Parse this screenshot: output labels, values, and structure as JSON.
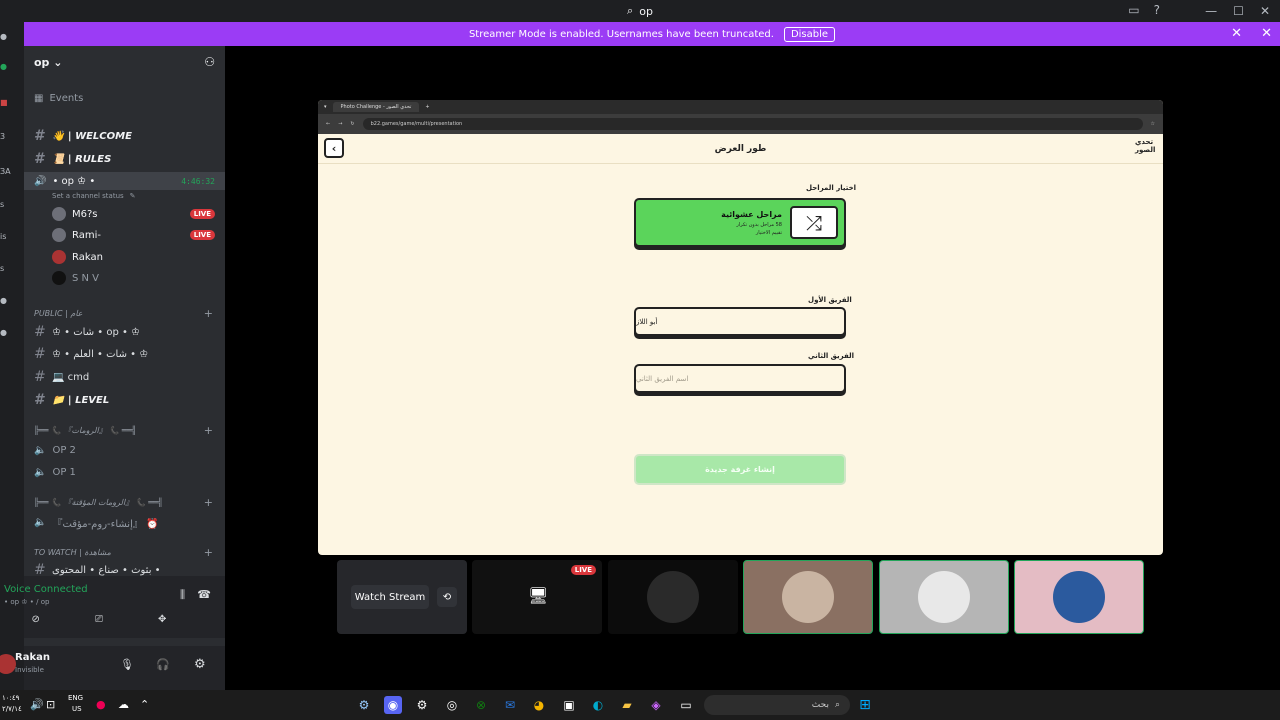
{
  "window": {
    "title": "op"
  },
  "banner": {
    "message": "Streamer Mode is enabled. Usernames have been truncated.",
    "disable_label": "Disable"
  },
  "server": {
    "name": "op",
    "events_label": "Events"
  },
  "channels": {
    "welcome": "👋 | WELCOME",
    "rules": "📜 | RULES",
    "voice_op": "• op ♔ •",
    "voice_timer": "4:46:32",
    "voice_status": "Set a channel status",
    "members": [
      {
        "name": "M6?s",
        "live": "LIVE"
      },
      {
        "name": "Rami-",
        "live": "LIVE"
      },
      {
        "name": "Rakan",
        "live": ""
      },
      {
        "name": "S N V",
        "live": ""
      }
    ],
    "public_cat": "PUBLIC | عام",
    "chat_op": "♔ • شات • op • ♔",
    "chat_alalam": "♔ • شات • العلم • ♔",
    "cmd": "💻 cmd",
    "level": "📁 | LEVEL",
    "rooms_cat": "╠══ 📞 『الرومات』 📞 ══╣",
    "op2": "OP 2",
    "op1": "OP 1",
    "temp_cat": "╠══ 📞 『الرومات المؤقتة』 📞 ══╣",
    "temp_room": "『إنشاء-روم-مؤقت』 ⏰",
    "watch_cat": "TO WATCH | مشاهدة",
    "watch_item": "بثوث • صناع • المحتوى •"
  },
  "voice": {
    "status": "Voice Connected",
    "channel": "• op ♔ • / op"
  },
  "user": {
    "name": "Rakan",
    "status": "Invisible"
  },
  "browser": {
    "tab_title": "Photo Challenge - تحدي الصور",
    "url": "b22.games/game/multi/presentation",
    "page_title": "طور العرض",
    "logo": "تحدي الصور",
    "stages_label": "اختيار المراحل",
    "random_title": "مراحل عشوائية",
    "random_sub1": "58 مراحل بدون تكرار",
    "random_sub2": "تقييم الاختيار",
    "team1_label": "الفريق الأول",
    "team1_value": "أبو اللاز",
    "team2_label": "الفريق الثاني",
    "team2_placeholder": "اسم الفريق الثاني",
    "create_button": "إنشاء غرفة جديدة"
  },
  "stage_tiles": {
    "watch_stream": "Watch Stream",
    "live_badge": "LIVE"
  },
  "taskbar": {
    "search_placeholder": "بحث",
    "lang": "ENG",
    "region": "US",
    "time": "١٠:٤٩",
    "date": "٢/٧/١٤"
  },
  "colors": {
    "banner": "#9b3cf5",
    "live": "#da373c",
    "voice_green": "#23a55a",
    "card_green": "#5bd45b"
  }
}
